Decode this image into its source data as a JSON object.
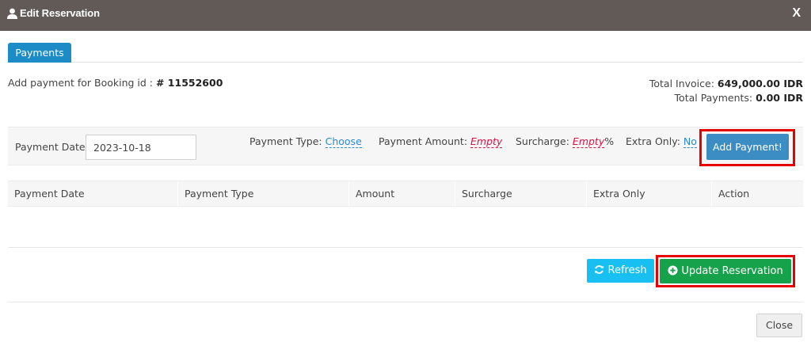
{
  "window": {
    "title": "Edit Reservation",
    "title_icon": "user-icon",
    "close_label": "X"
  },
  "tabs": [
    {
      "label": "Payments",
      "active": true
    }
  ],
  "booking": {
    "prefix": "Add payment for Booking id :",
    "id": "# 11552600"
  },
  "totals": {
    "invoice_label": "Total Invoice:",
    "invoice_value": "649,000.00 IDR",
    "payments_label": "Total Payments:",
    "payments_value": "0.00 IDR"
  },
  "form": {
    "date_label": "Payment Date:",
    "date_value": "2023-10-18",
    "type_label": "Payment Type:",
    "type_value": "Choose",
    "amount_label": "Payment Amount:",
    "amount_value": "Empty",
    "surcharge_label": "Surcharge:",
    "surcharge_value": "Empty",
    "surcharge_unit": "%",
    "extra_label": "Extra Only:",
    "extra_value": "No",
    "add_button": "Add Payment!"
  },
  "table": {
    "columns": [
      "Payment Date",
      "Payment Type",
      "Amount",
      "Surcharge",
      "Extra Only",
      "Action"
    ],
    "rows": []
  },
  "actions": {
    "refresh": "Refresh",
    "refresh_icon": "refresh-icon",
    "update": "Update Reservation",
    "update_icon": "plus-circle-icon",
    "close": "Close"
  },
  "colors": {
    "titlebar": "#625a56",
    "tab_active": "#1d8bc6",
    "add_button": "#3b8dc4",
    "refresh_button": "#17c0f0",
    "update_button": "#16a24a",
    "highlight": "#e60000",
    "empty_value": "#dd1144",
    "editable_link": "#2a8bd1"
  }
}
